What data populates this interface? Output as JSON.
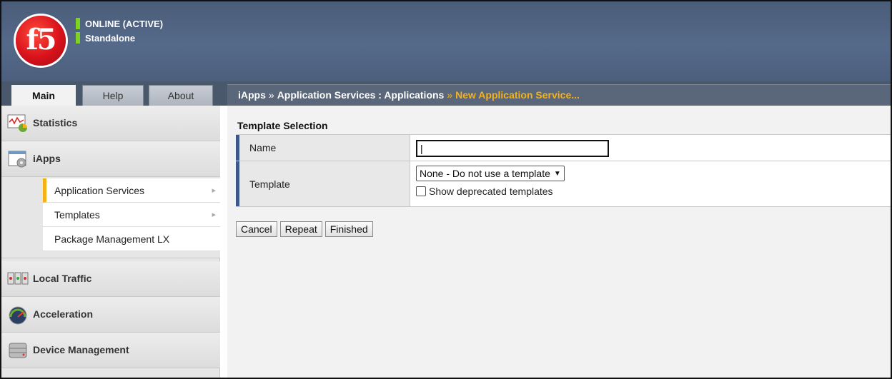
{
  "header": {
    "logo_text": "f5",
    "status_lines": [
      "ONLINE (ACTIVE)",
      "Standalone"
    ]
  },
  "tabs": [
    {
      "label": "Main",
      "active": true
    },
    {
      "label": "Help",
      "active": false
    },
    {
      "label": "About",
      "active": false
    }
  ],
  "breadcrumb": {
    "part1": "iApps",
    "part2": "Application Services : Applications",
    "current": "New Application Service...",
    "separator": "»"
  },
  "sidebar": {
    "items": [
      {
        "label": "Statistics",
        "icon": "statistics-icon"
      },
      {
        "label": "iApps",
        "icon": "iapps-icon"
      },
      {
        "label": "Local Traffic",
        "icon": "local-traffic-icon"
      },
      {
        "label": "Acceleration",
        "icon": "acceleration-icon"
      },
      {
        "label": "Device Management",
        "icon": "device-management-icon"
      }
    ],
    "subitems": [
      {
        "label": "Application Services",
        "active": true
      },
      {
        "label": "Templates",
        "active": false
      },
      {
        "label": "Package Management LX",
        "active": false
      }
    ]
  },
  "form": {
    "section_title": "Template Selection",
    "name_label": "Name",
    "name_value": "|",
    "template_label": "Template",
    "template_selected": "None - Do not use a template",
    "show_deprecated_label": "Show deprecated templates"
  },
  "buttons": {
    "cancel": "Cancel",
    "repeat": "Repeat",
    "finished": "Finished"
  },
  "colors": {
    "header_bg": "#4f6280",
    "accent_yellow": "#f5b217",
    "status_green": "#7ed321",
    "label_border_blue": "#3b5a8a"
  }
}
